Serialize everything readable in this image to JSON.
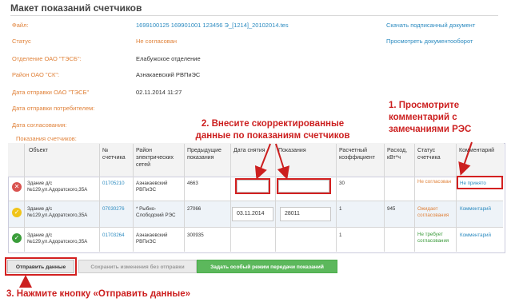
{
  "page": {
    "title": "Макет показаний счетчиков"
  },
  "info": [
    {
      "label": "Файл:",
      "value": "1699100125 169901001 123456 Э_[1214]_20102014.tes",
      "is_link": true
    },
    {
      "label": "Статус",
      "value": "Не согласован",
      "is_link": false
    },
    {
      "label": "Отделение ОАО \"ТЭСБ\":",
      "value": "Елабужское отделение",
      "is_link": false
    },
    {
      "label": "Район ОАО \"СК\":",
      "value": "Азнакаевский РВПиЭС",
      "is_link": false
    },
    {
      "label": "Дата отправки ОАО \"ТЭСБ\"",
      "value": "02.11.2014 11:27",
      "is_link": false
    },
    {
      "label": "Дата отправки потребителем:",
      "value": "",
      "is_link": false
    },
    {
      "label": "Дата согласования:",
      "value": "",
      "is_link": false
    }
  ],
  "links": {
    "download": "Скачать подписанный документ",
    "workflow": "Просмотреть документооборот"
  },
  "section_title": "Показания счетчиков:",
  "table": {
    "headers": {
      "object": "Объект",
      "meter_no": "№ счетчика",
      "network_region": "Район электрических сетей",
      "prev_reading": "Предыдущие показания",
      "date": "Дата снятия",
      "reading": "Показания",
      "coef": "Расчетный коэффициент",
      "consumption": "Расход, кВт*ч",
      "status": "Статус счетчика",
      "comment": "Комментарий"
    },
    "rows": [
      {
        "state_icon": "x-icon",
        "state_color": "#d9534f",
        "object": "Здание д/с №129,ул.Адоратского,35А",
        "meter_no": "01705210",
        "network_region": "Азнакаевский РВПиЭС",
        "prev_reading": "4663",
        "date": "",
        "reading": "",
        "coef": "30",
        "consumption": "",
        "status": "Не согласован",
        "comment": "Не принято"
      },
      {
        "state_icon": "check-icon",
        "state_color": "#f0c419",
        "object": "Здание д/с №129,ул.Адоратского,35А",
        "meter_no": "07030276",
        "network_region": "* Рыбно-Слободский РЭС",
        "prev_reading": "27066",
        "date": "03.11.2014",
        "reading": "28011",
        "coef": "1",
        "consumption": "945",
        "status": "Ожидает согласования",
        "comment": "Комментарий"
      },
      {
        "state_icon": "check-icon",
        "state_color": "#3a9d3a",
        "object": "Здание д/с №129,ул.Адоратского,35А",
        "meter_no": "01703264",
        "network_region": "Азнакаевский РВПиЭС",
        "prev_reading": "300935",
        "date": "",
        "reading": "",
        "coef": "1",
        "consumption": "",
        "status": "Не требует согласования",
        "comment": "Комментарий"
      }
    ]
  },
  "buttons": {
    "send": "Отправить данные",
    "save": "Сохранить изменения без отправки",
    "special": "Задать особый режим передачи показаний"
  },
  "annotations": {
    "step1": "1. Просмотрите комментарий с замечаниями РЭС",
    "step2": "2. Внесите скорректированные данные по показаниям счетчиков",
    "step3": "3. Нажмите кнопку «Отправить данные»"
  },
  "colors": {
    "label_orange": "#e0823a",
    "link_blue": "#2c8bc0",
    "annotation_red": "#cc1f1f",
    "button_green": "#5cb85c"
  }
}
